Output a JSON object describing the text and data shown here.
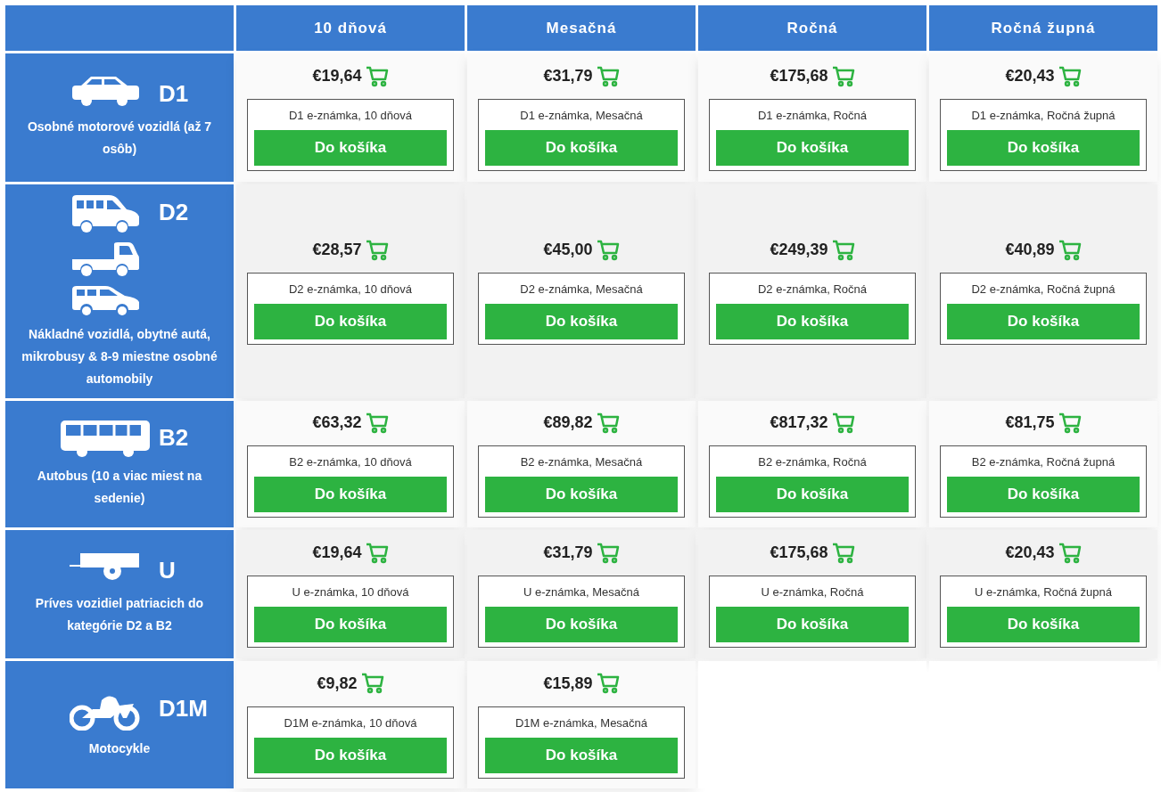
{
  "columns": [
    {
      "label": "10 dňová"
    },
    {
      "label": "Mesačná"
    },
    {
      "label": "Ročná"
    },
    {
      "label": "Ročná župná"
    }
  ],
  "rows": [
    {
      "code": "D1",
      "description": "Osobné motorové vozidlá (až 7 osôb)",
      "icons": [
        {
          "kind": "car"
        }
      ],
      "offers": [
        {
          "price": "€19,64",
          "product": "D1 e-známka, 10 dňová",
          "button": "Do košíka"
        },
        {
          "price": "€31,79",
          "product": "D1 e-známka, Mesačná",
          "button": "Do košíka"
        },
        {
          "price": "€175,68",
          "product": "D1 e-známka, Ročná",
          "button": "Do košíka"
        },
        {
          "price": "€20,43",
          "product": "D1 e-známka, Ročná župná",
          "button": "Do košíka"
        }
      ]
    },
    {
      "code": "D2",
      "description": "Nákladné vozidlá, obytné autá, mikrobusy & 8-9 miestne osobné automobily",
      "icons": [
        {
          "kind": "van"
        },
        {
          "kind": "truck"
        },
        {
          "kind": "minivan"
        }
      ],
      "offers": [
        {
          "price": "€28,57",
          "product": "D2 e-známka, 10 dňová",
          "button": "Do košíka"
        },
        {
          "price": "€45,00",
          "product": "D2 e-známka, Mesačná",
          "button": "Do košíka"
        },
        {
          "price": "€249,39",
          "product": "D2 e-známka, Ročná",
          "button": "Do košíka"
        },
        {
          "price": "€40,89",
          "product": "D2 e-známka, Ročná župná",
          "button": "Do košíka"
        }
      ]
    },
    {
      "code": "B2",
      "description": "Autobus (10 a viac miest na sedenie)",
      "icons": [
        {
          "kind": "bus"
        }
      ],
      "offers": [
        {
          "price": "€63,32",
          "product": "B2 e-známka, 10 dňová",
          "button": "Do košíka"
        },
        {
          "price": "€89,82",
          "product": "B2 e-známka, Mesačná",
          "button": "Do košíka"
        },
        {
          "price": "€817,32",
          "product": "B2 e-známka, Ročná",
          "button": "Do košíka"
        },
        {
          "price": "€81,75",
          "product": "B2 e-známka, Ročná župná",
          "button": "Do košíka"
        }
      ]
    },
    {
      "code": "U",
      "description": "Príves vozidiel patriacich do kategórie D2 a B2",
      "icons": [
        {
          "kind": "trailer"
        }
      ],
      "offers": [
        {
          "price": "€19,64",
          "product": "U e-známka, 10 dňová",
          "button": "Do košíka"
        },
        {
          "price": "€31,79",
          "product": "U e-známka, Mesačná",
          "button": "Do košíka"
        },
        {
          "price": "€175,68",
          "product": "U e-známka, Ročná",
          "button": "Do košíka"
        },
        {
          "price": "€20,43",
          "product": "U e-známka, Ročná župná",
          "button": "Do košíka"
        }
      ]
    },
    {
      "code": "D1M",
      "description": "Motocykle",
      "icons": [
        {
          "kind": "motorcycle"
        }
      ],
      "offers": [
        {
          "price": "€9,82",
          "product": "D1M e-známka, 10 dňová",
          "button": "Do košíka"
        },
        {
          "price": "€15,89",
          "product": "D1M e-známka, Mesačná",
          "button": "Do košíka"
        }
      ]
    }
  ]
}
